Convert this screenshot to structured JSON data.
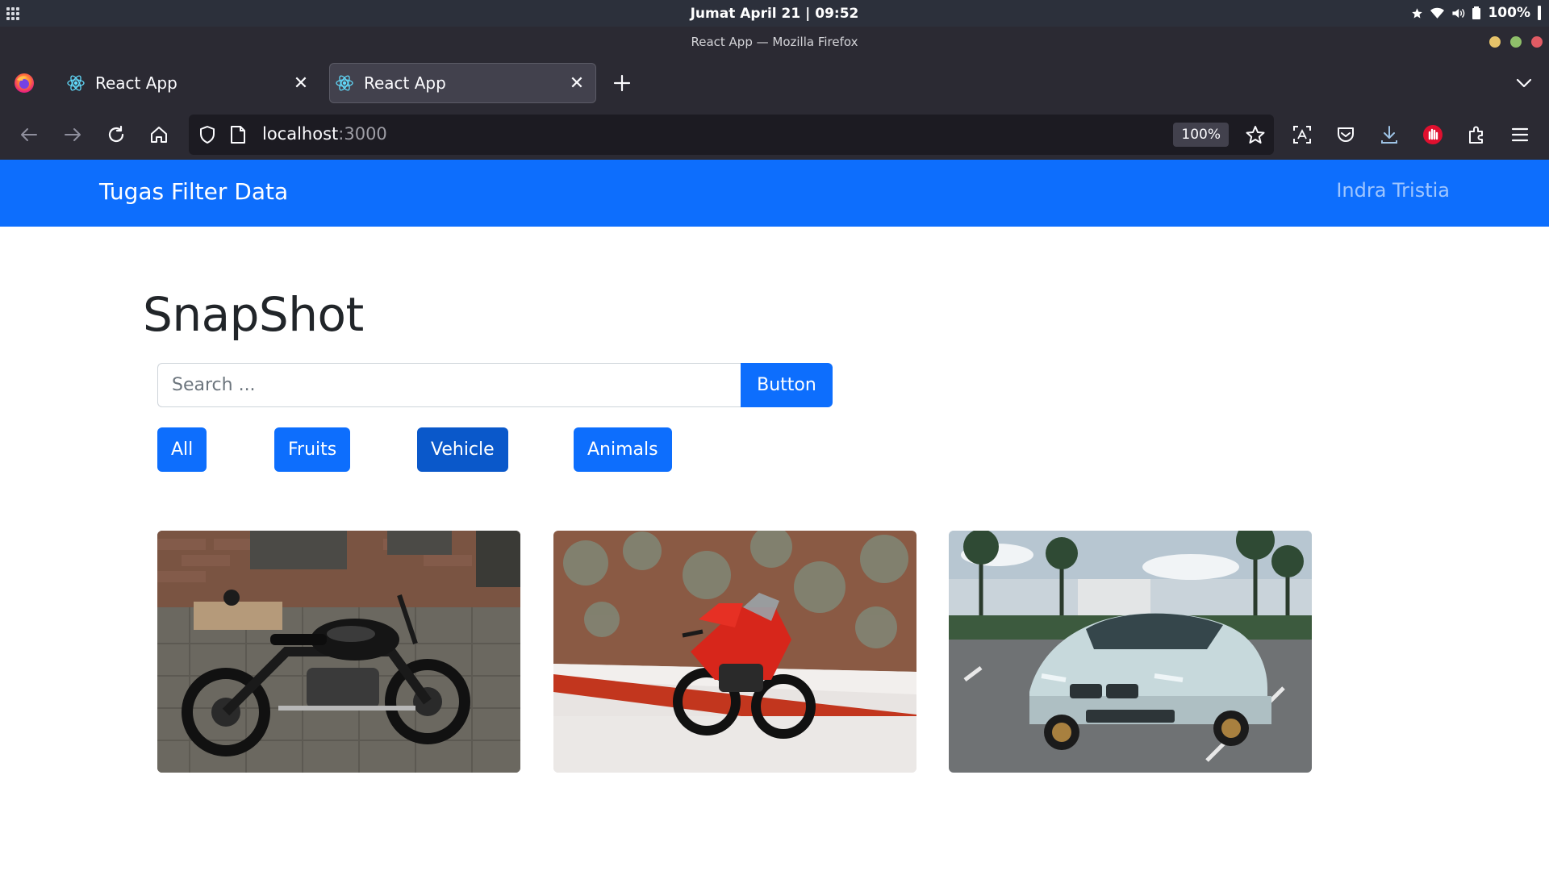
{
  "os": {
    "clock": "Jumat April 21 | 09:52",
    "battery": "100%"
  },
  "window": {
    "title": "React App — Mozilla Firefox",
    "dot_colors": [
      "#e6c36a",
      "#8fbf6a",
      "#e15b64"
    ]
  },
  "tabs": [
    {
      "label": "React App",
      "active": false
    },
    {
      "label": "React App",
      "active": true
    }
  ],
  "toolbar": {
    "url_host": "localhost",
    "url_port": ":3000",
    "zoom": "100%"
  },
  "app": {
    "brand": "Tugas Filter Data",
    "user": "Indra Tristia",
    "title": "SnapShot",
    "search": {
      "placeholder": "Search ...",
      "value": "",
      "button_label": "Button"
    },
    "filters": [
      {
        "label": "All",
        "active": false
      },
      {
        "label": "Fruits",
        "active": false
      },
      {
        "label": "Vehicle",
        "active": true
      },
      {
        "label": "Animals",
        "active": false
      }
    ],
    "images": [
      {
        "subject": "black-motorcycle-photo"
      },
      {
        "subject": "red-sport-motorcycle-photo"
      },
      {
        "subject": "white-sedan-car-photo"
      }
    ]
  },
  "colors": {
    "primary": "#0d6efd",
    "primary_active": "#0a58ca",
    "browser_chrome": "#2b2a33",
    "urlbar_bg": "#1c1b22"
  }
}
